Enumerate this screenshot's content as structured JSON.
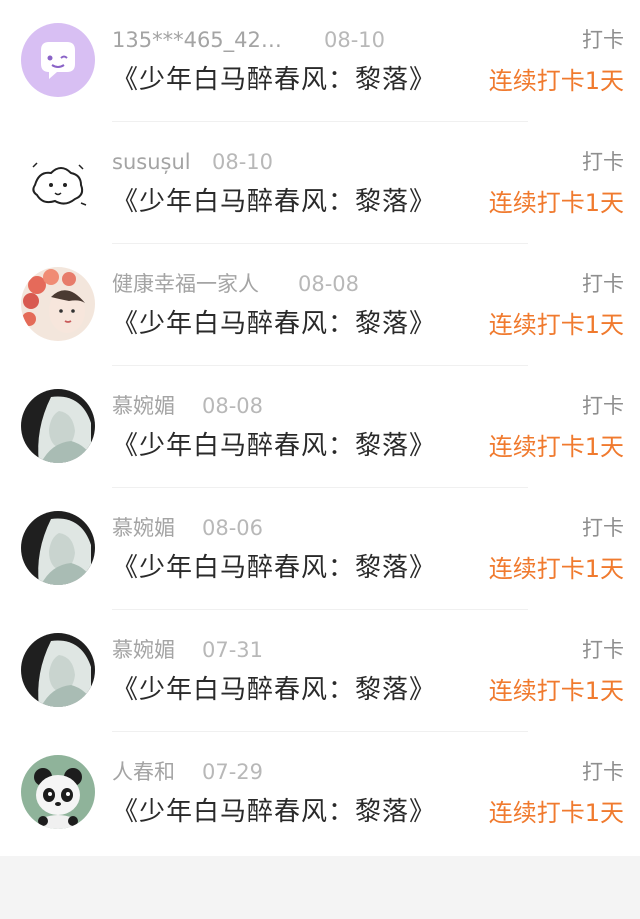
{
  "rows": [
    {
      "name": "135***465_42…",
      "date": "08-10",
      "tag": "打卡",
      "title": "《少年白马醉春风：黎落》",
      "streak": "连续打卡1天"
    },
    {
      "name": "susușul",
      "date": "08-10",
      "tag": "打卡",
      "title": "《少年白马醉春风：黎落》",
      "streak": "连续打卡1天"
    },
    {
      "name": "健康幸福一家人",
      "date": "08-08",
      "tag": "打卡",
      "title": "《少年白马醉春风：黎落》",
      "streak": "连续打卡1天"
    },
    {
      "name": "慕婉媚",
      "date": "08-08",
      "tag": "打卡",
      "title": "《少年白马醉春风：黎落》",
      "streak": "连续打卡1天"
    },
    {
      "name": "慕婉媚",
      "date": "08-06",
      "tag": "打卡",
      "title": "《少年白马醉春风：黎落》",
      "streak": "连续打卡1天"
    },
    {
      "name": "慕婉媚",
      "date": "07-31",
      "tag": "打卡",
      "title": "《少年白马醉春风：黎落》",
      "streak": "连续打卡1天"
    },
    {
      "name": "人春和",
      "date": "07-29",
      "tag": "打卡",
      "title": "《少年白马醉春风：黎落》",
      "streak": "连续打卡1天"
    }
  ],
  "colors": {
    "streak": "#f07a2e",
    "name": "#a4a4a4",
    "title": "#2a2a2a",
    "divider": "#f0f0f0"
  }
}
